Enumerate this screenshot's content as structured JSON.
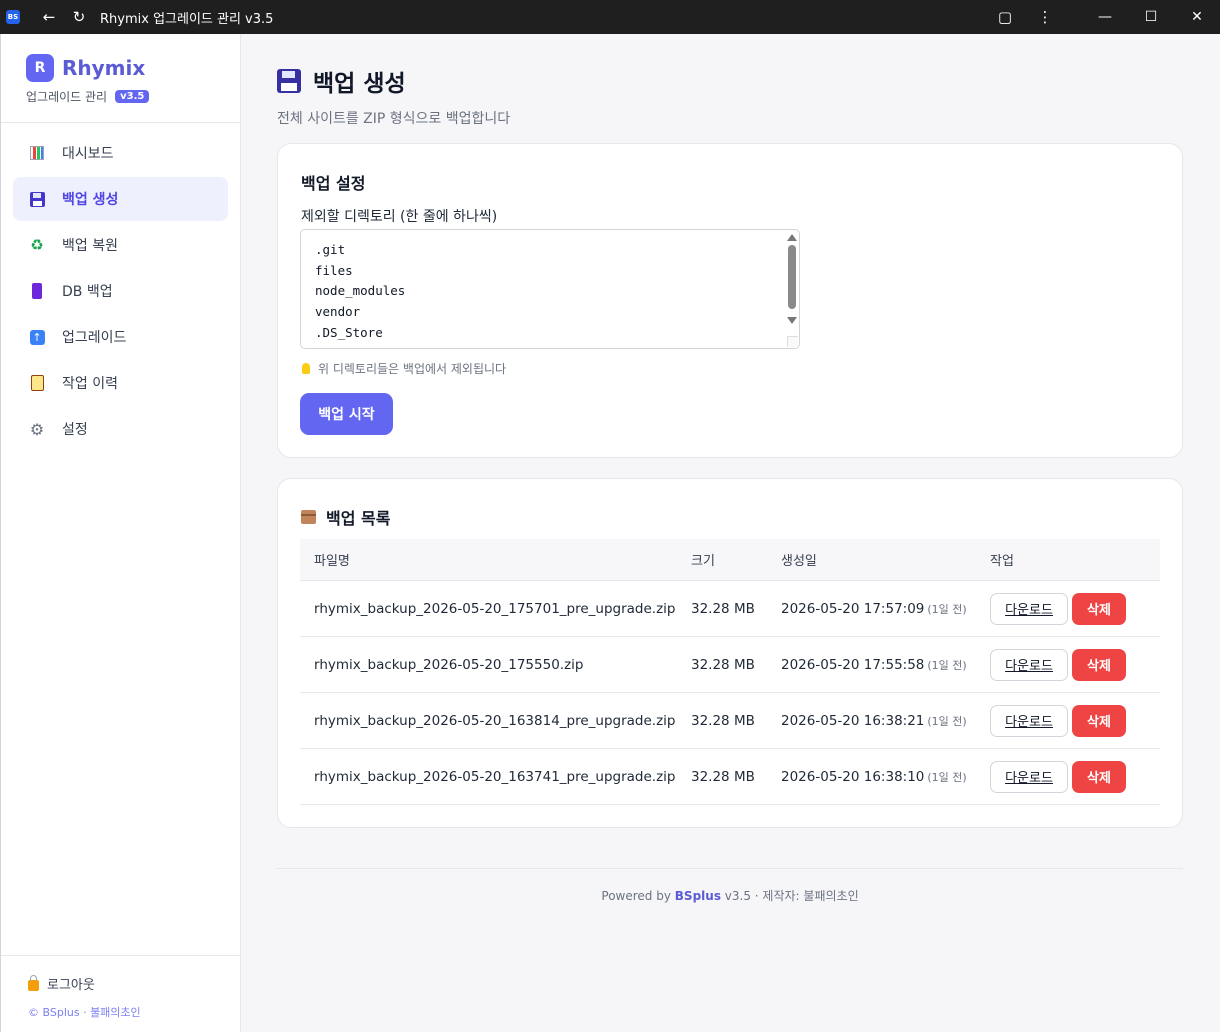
{
  "window": {
    "app_badge": "BS",
    "title": "Rhymix 업그레이드 관리 v3.5"
  },
  "sidebar": {
    "logo_letter": "R",
    "brand": "Rhymix",
    "subtitle": "업그레이드 관리",
    "version": "v3.5",
    "items": [
      {
        "label": "대시보드",
        "icon": "chart-icon",
        "active": false
      },
      {
        "label": "백업 생성",
        "icon": "floppy-disk-icon",
        "active": true
      },
      {
        "label": "백업 복원",
        "icon": "recycle-icon",
        "active": false
      },
      {
        "label": "DB 백업",
        "icon": "database-icon",
        "active": false
      },
      {
        "label": "업그레이드",
        "icon": "up-arrow-icon",
        "active": false
      },
      {
        "label": "작업 이력",
        "icon": "clipboard-icon",
        "active": false
      },
      {
        "label": "설정",
        "icon": "gear-icon",
        "active": false
      }
    ],
    "logout": "로그아웃",
    "copyright": "© BSplus · 불패의초인"
  },
  "page": {
    "title": "백업 생성",
    "subtitle": "전체 사이트를 ZIP 형식으로 백업합니다"
  },
  "backup_settings": {
    "title": "백업 설정",
    "field_label": "제외할 디렉토리 (한 줄에 하나씩)",
    "excluded_dirs": [
      ".git",
      "files",
      "node_modules",
      "vendor",
      ".DS_Store"
    ],
    "hint": "위 디렉토리들은 백업에서 제외됩니다",
    "start_button": "백업 시작"
  },
  "backup_list": {
    "title": "백업 목록",
    "columns": [
      "파일명",
      "크기",
      "생성일",
      "작업"
    ],
    "rows": [
      {
        "filename": "rhymix_backup_2026-05-20_175701_pre_upgrade.zip",
        "size": "32.28 MB",
        "date": "2026-05-20 17:57:09",
        "relative": "(1일 전)"
      },
      {
        "filename": "rhymix_backup_2026-05-20_175550.zip",
        "size": "32.28 MB",
        "date": "2026-05-20 17:55:58",
        "relative": "(1일 전)"
      },
      {
        "filename": "rhymix_backup_2026-05-20_163814_pre_upgrade.zip",
        "size": "32.28 MB",
        "date": "2026-05-20 16:38:21",
        "relative": "(1일 전)"
      },
      {
        "filename": "rhymix_backup_2026-05-20_163741_pre_upgrade.zip",
        "size": "32.28 MB",
        "date": "2026-05-20 16:38:10",
        "relative": "(1일 전)"
      }
    ],
    "download_label": "다운로드",
    "delete_label": "삭제"
  },
  "footer": {
    "prefix": "Powered by",
    "brand": "BSplus",
    "suffix": "v3.5 · 제작자: 불패의초인"
  },
  "colors": {
    "accent": "#6366f1",
    "danger": "#ef4444"
  }
}
